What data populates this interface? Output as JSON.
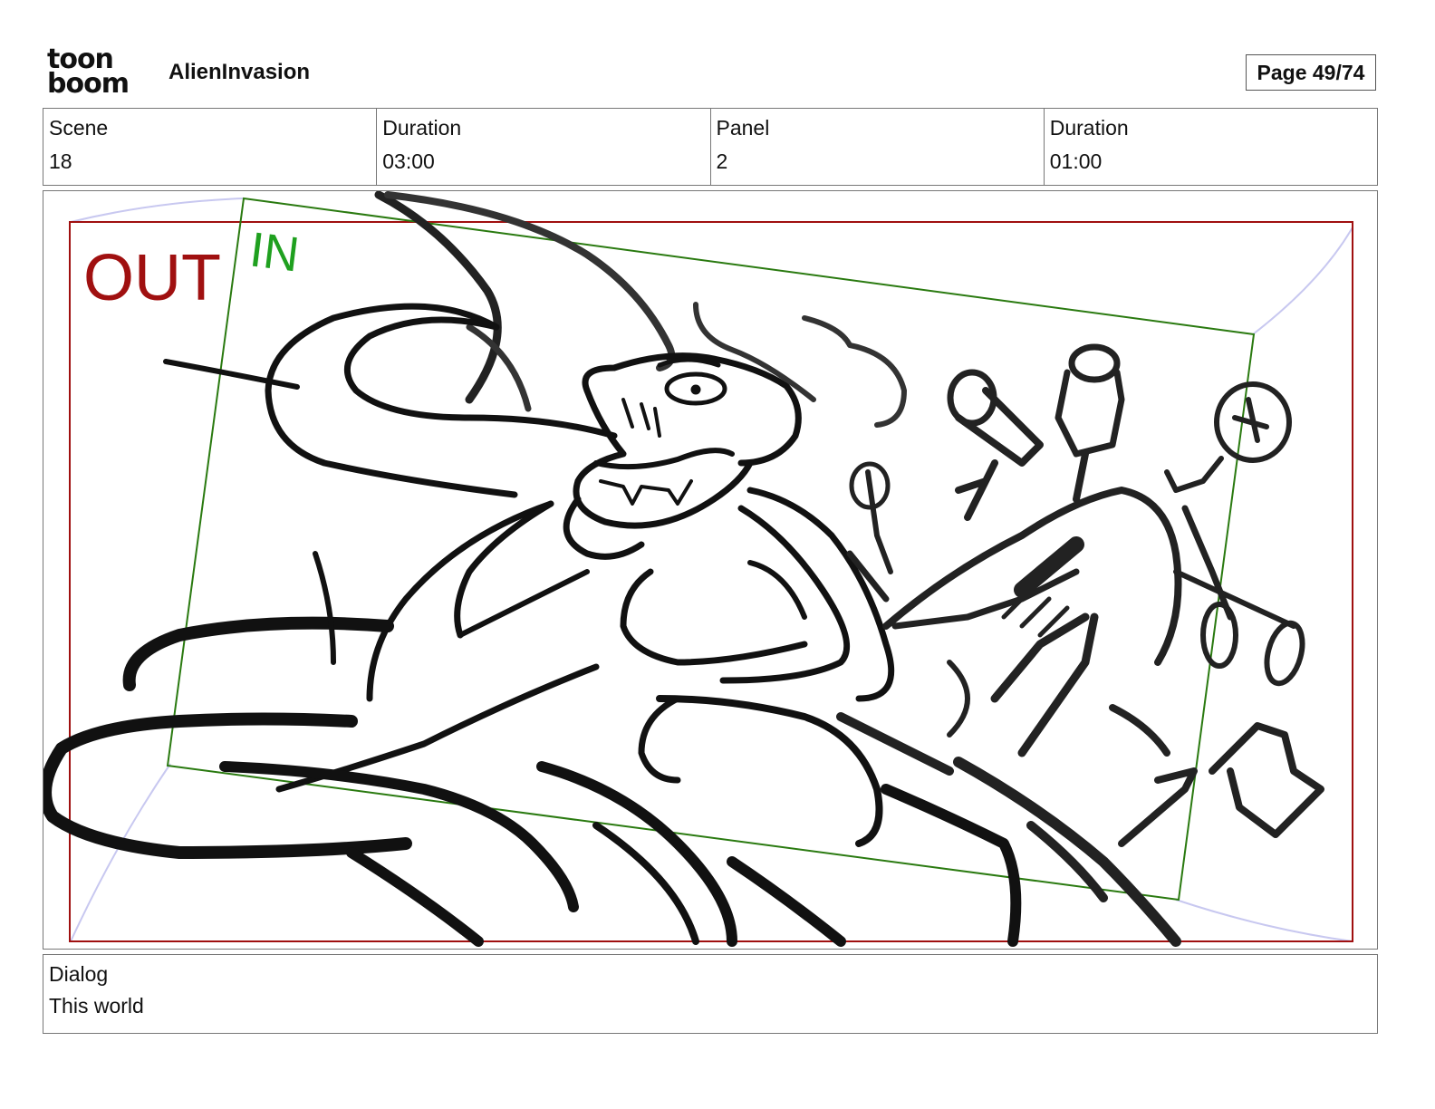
{
  "header": {
    "logo_line1": "toon",
    "logo_line2": "boom",
    "project_title": "AlienInvasion",
    "page_label": "Page 49/74"
  },
  "info": {
    "scene_label": "Scene",
    "scene_value": "18",
    "scene_duration_label": "Duration",
    "scene_duration_value": "03:00",
    "panel_label": "Panel",
    "panel_value": "2",
    "panel_duration_label": "Duration",
    "panel_duration_value": "01:00"
  },
  "panel": {
    "out_label": "OUT",
    "in_label": "IN",
    "out_color": "#a01010",
    "in_color": "#2a7a10"
  },
  "dialog": {
    "label": "Dialog",
    "text": "This world"
  }
}
